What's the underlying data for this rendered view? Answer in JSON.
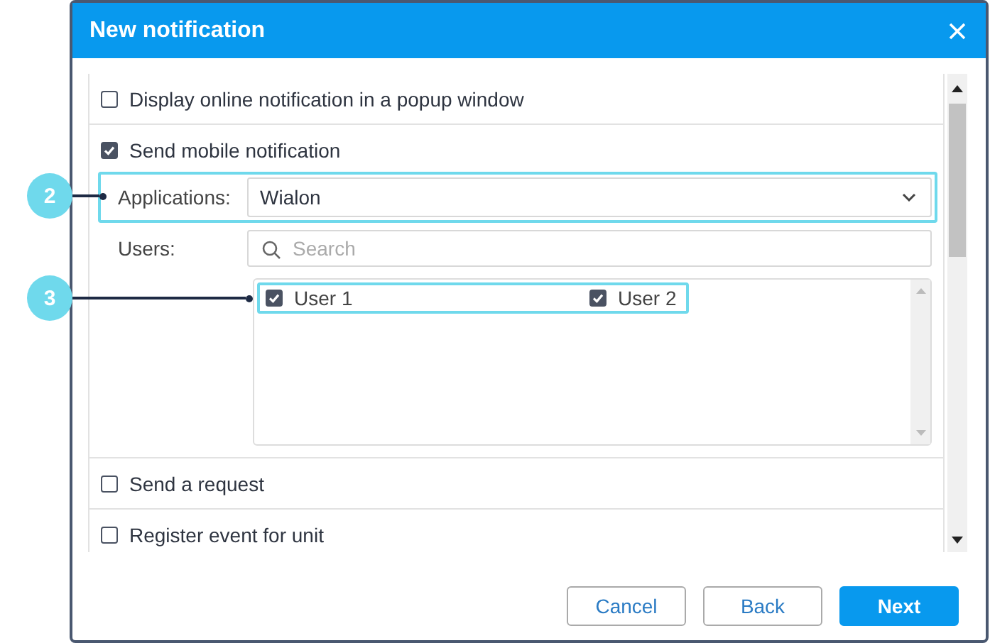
{
  "dialog": {
    "title": "New notification"
  },
  "options": [
    {
      "kind": "simple",
      "label": "Display online notification in a popup window",
      "checked": false
    },
    {
      "kind": "mobile",
      "label": "Send mobile notification",
      "checked": true,
      "applications_label": "Applications:",
      "applications_value": "Wialon",
      "users_label": "Users:",
      "search_placeholder": "Search",
      "users": [
        {
          "name": "User 1",
          "checked": true
        },
        {
          "name": "User 2",
          "checked": true
        }
      ]
    },
    {
      "kind": "simple",
      "label": "Send a request",
      "checked": false
    },
    {
      "kind": "simple",
      "label": "Register event for unit",
      "checked": false
    }
  ],
  "callouts": [
    {
      "number": "2"
    },
    {
      "number": "3"
    }
  ],
  "buttons": [
    {
      "label": "Cancel",
      "kind": "secondary"
    },
    {
      "label": "Back",
      "kind": "secondary"
    },
    {
      "label": "Next",
      "kind": "primary"
    }
  ]
}
